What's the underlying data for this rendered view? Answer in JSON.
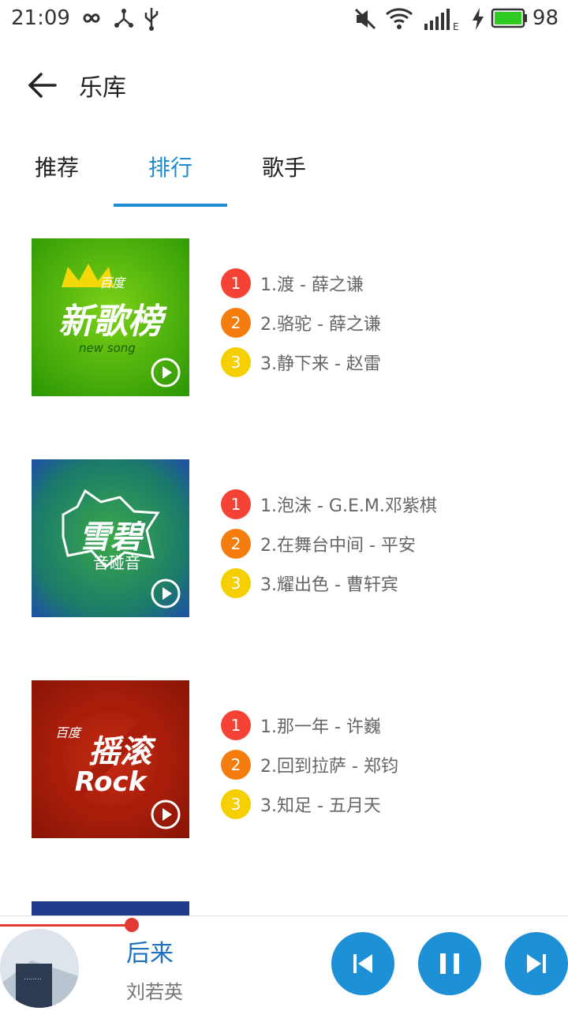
{
  "status_bar": {
    "time": "21:09",
    "battery_percent": "98",
    "battery_color": "#2ecc20"
  },
  "header": {
    "title": "乐库"
  },
  "tabs": [
    {
      "label": "推荐"
    },
    {
      "label": "排行"
    },
    {
      "label": "歌手"
    }
  ],
  "active_tab_color": "#1f8ccf",
  "charts": [
    {
      "cover_icon": "new-song-cover",
      "cover_texts": {
        "brand": "百度",
        "name": "新歌榜",
        "sub": "new song"
      },
      "songs": [
        {
          "rank": "1",
          "text": "1.渡 - 薛之谦"
        },
        {
          "rank": "2",
          "text": "2.骆驼 - 薛之谦"
        },
        {
          "rank": "3",
          "text": "3.静下来 - 赵雷"
        }
      ]
    },
    {
      "cover_icon": "sprite-cover",
      "cover_texts": {
        "name": "雪碧",
        "sub": "音碰音"
      },
      "songs": [
        {
          "rank": "1",
          "text": "1.泡沫 - G.E.M.邓紫棋"
        },
        {
          "rank": "2",
          "text": "2.在舞台中间 - 平安"
        },
        {
          "rank": "3",
          "text": "3.耀出色 - 曹轩宾"
        }
      ]
    },
    {
      "cover_icon": "rock-cover",
      "cover_texts": {
        "brand": "百度",
        "name": "摇滚",
        "sub": "Rock"
      },
      "songs": [
        {
          "rank": "1",
          "text": "1.那一年 - 许巍"
        },
        {
          "rank": "2",
          "text": "2.回到拉萨 - 郑钧"
        },
        {
          "rank": "3",
          "text": "3.知足 - 五月天"
        }
      ]
    }
  ],
  "player": {
    "song_title": "后来",
    "artist": "刘若英",
    "controls": [
      "previous-icon",
      "pause-icon",
      "next-icon"
    ],
    "accent_color": "#1e90d6",
    "progress_fraction": 0.23
  }
}
